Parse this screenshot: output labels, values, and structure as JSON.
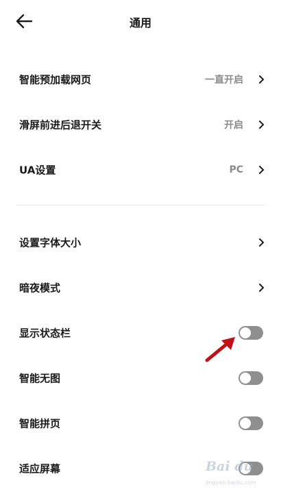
{
  "header": {
    "title": "通用",
    "back_icon": "arrow-left-icon"
  },
  "group1": [
    {
      "label": "智能预加载网页",
      "value": "一直开启"
    },
    {
      "label": "滑屏前进后退开关",
      "value": "开启"
    },
    {
      "label": "UA设置",
      "value": "PC"
    }
  ],
  "group2": {
    "font_size": {
      "label": "设置字体大小"
    },
    "dark_mode": {
      "label": "暗夜模式"
    },
    "status_bar": {
      "label": "显示状态栏",
      "enabled": false
    },
    "no_image": {
      "label": "智能无图",
      "enabled": false
    },
    "page_join": {
      "label": "智能拼页",
      "enabled": false
    },
    "fit_screen": {
      "label": "适应屏幕",
      "enabled": false
    }
  },
  "annotation": {
    "arrow_color": "#c0101a"
  },
  "watermark": {
    "logo": "Bai du",
    "sub": "jingyan.baidu.com"
  },
  "colors": {
    "toggle_off": "#8f8f8f",
    "value_text": "#8a8a8a"
  }
}
